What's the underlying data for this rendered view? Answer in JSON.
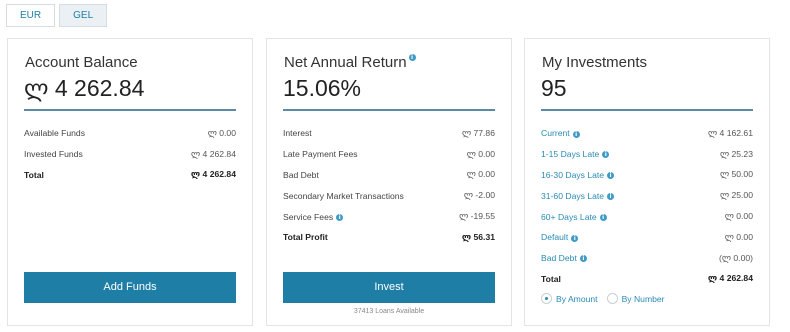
{
  "currency_tabs": [
    {
      "label": "EUR"
    },
    {
      "label": "GEL"
    }
  ],
  "account_balance": {
    "title": "Account Balance",
    "value": "ლ 4 262.84",
    "rows": [
      {
        "label": "Available Funds",
        "value": "ლ 0.00"
      },
      {
        "label": "Invested Funds",
        "value": "ლ 4 262.84"
      }
    ],
    "total": {
      "label": "Total",
      "value": "ლ 4 262.84"
    },
    "button": "Add Funds"
  },
  "net_annual_return": {
    "title": "Net Annual Return",
    "value": "15.06%",
    "rows": [
      {
        "label": "Interest",
        "value": "ლ 77.86"
      },
      {
        "label": "Late Payment Fees",
        "value": "ლ 0.00"
      },
      {
        "label": "Bad Debt",
        "value": "ლ 0.00"
      },
      {
        "label": "Secondary Market Transactions",
        "value": "ლ -2.00"
      },
      {
        "label": "Service Fees",
        "value": "ლ -19.55"
      }
    ],
    "total": {
      "label": "Total Profit",
      "value": "ლ 56.31"
    },
    "button": "Invest",
    "note": "37413 Loans Available"
  },
  "my_investments": {
    "title": "My Investments",
    "value": "95",
    "rows": [
      {
        "label": "Current",
        "value": "ლ 4 162.61"
      },
      {
        "label": "1-15 Days Late",
        "value": "ლ 25.23"
      },
      {
        "label": "16-30 Days Late",
        "value": "ლ 50.00"
      },
      {
        "label": "31-60 Days Late",
        "value": "ლ 25.00"
      },
      {
        "label": "60+ Days Late",
        "value": "ლ 0.00"
      },
      {
        "label": "Default",
        "value": "ლ 0.00"
      },
      {
        "label": "Bad Debt",
        "value": "(ლ 0.00)"
      }
    ],
    "total": {
      "label": "Total",
      "value": "ლ 4 262.84"
    },
    "radio_options": [
      {
        "label": "By Amount",
        "selected": true
      },
      {
        "label": "By Number",
        "selected": false
      }
    ]
  },
  "colors": {
    "accent": "#1e7ea6",
    "link": "#2a8ab4",
    "rule": "#5b8ba3"
  }
}
